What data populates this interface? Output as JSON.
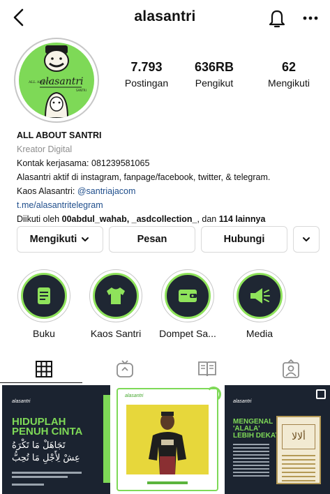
{
  "header": {
    "username": "alasantri"
  },
  "profile": {
    "avatar_brand": "alasantri",
    "avatar_small_left": "ALL ABOUT",
    "avatar_small_right": "SANTRI",
    "stats": [
      {
        "value": "7.793",
        "label": "Postingan"
      },
      {
        "value": "636RB",
        "label": "Pengikut"
      },
      {
        "value": "62",
        "label": "Mengikuti"
      }
    ],
    "name": "ALL ABOUT SANTRI",
    "category": "Kreator Digital",
    "contact": "Kontak kerjasama: 081239581065",
    "bio_line": "Alasantri aktif di instagram, fanpage/facebook, twitter, & telegram.",
    "kaos_prefix": "Kaos Alasantri: ",
    "kaos_handle": "@santriajacom",
    "website": "t.me/alasantritelegram",
    "followed_prefix": "Diikuti oleh ",
    "followed_users": "00abdul_wahab, _asdcollection_",
    "followed_mid": ", dan ",
    "followed_count": "114 lainnya"
  },
  "actions": {
    "follow_label": "Mengikuti",
    "message_label": "Pesan",
    "contact_label": "Hubungi"
  },
  "highlights": [
    {
      "label": "Buku",
      "icon": "book-icon"
    },
    {
      "label": "Kaos Santri",
      "icon": "tshirt-icon"
    },
    {
      "label": "Dompet Sa...",
      "icon": "wallet-icon"
    },
    {
      "label": "Media",
      "icon": "megaphone-icon"
    }
  ],
  "tabs": [
    "grid-icon",
    "reels-icon",
    "guide-icon",
    "tagged-icon"
  ],
  "posts": [
    {
      "brand": "alasantri",
      "title_1": "HIDUPLAH",
      "title_2": "PENUH CINTA",
      "arabic_1": "تَجَاهَلْ مَا تَكْرَهُ",
      "arabic_2": "عِشْ لِأَجْلِ مَا تُحِبُّ"
    },
    {
      "brand": "alasantri"
    },
    {
      "brand": "alasantri",
      "title_1": "MENGENAL",
      "title_2": "'ALALA'",
      "title_3": "LEBIH DEKAT",
      "book_title": "ألالا"
    }
  ],
  "colors": {
    "accent_green": "#7ed957",
    "dark_navy": "#1f2733",
    "link_blue": "#1f4e8c"
  }
}
